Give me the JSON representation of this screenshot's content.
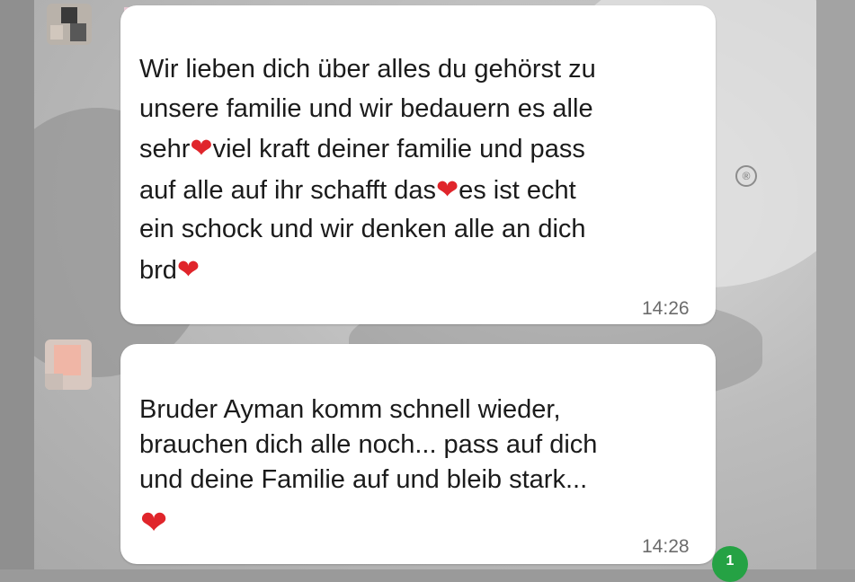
{
  "chat": {
    "messages": [
      {
        "lines": [
          "Wir lieben dich über alles du gehörst zu",
          "unsere familie und wir bedauern es alle",
          "sehr",
          "viel kraft deiner familie und pass",
          "auf alle auf ihr schafft das",
          "es ist echt",
          "ein schock und wir denken alle an dich",
          "brd"
        ],
        "time": "14:26"
      },
      {
        "lines": [
          "Bruder Ayman komm schnell wieder,",
          "brauchen dich alle noch... pass auf dich",
          "und deine Familie auf und bleib stark..."
        ],
        "time": "14:28"
      }
    ],
    "heart_icon": "red-heart-emoji",
    "heart_char": "❤",
    "unread_count": "1",
    "registered_mark": "®"
  },
  "colors": {
    "bubble": "#ffffff",
    "heart": "#e0252b",
    "unread_badge": "#25a244",
    "timestamp": "#6b6b6b"
  }
}
